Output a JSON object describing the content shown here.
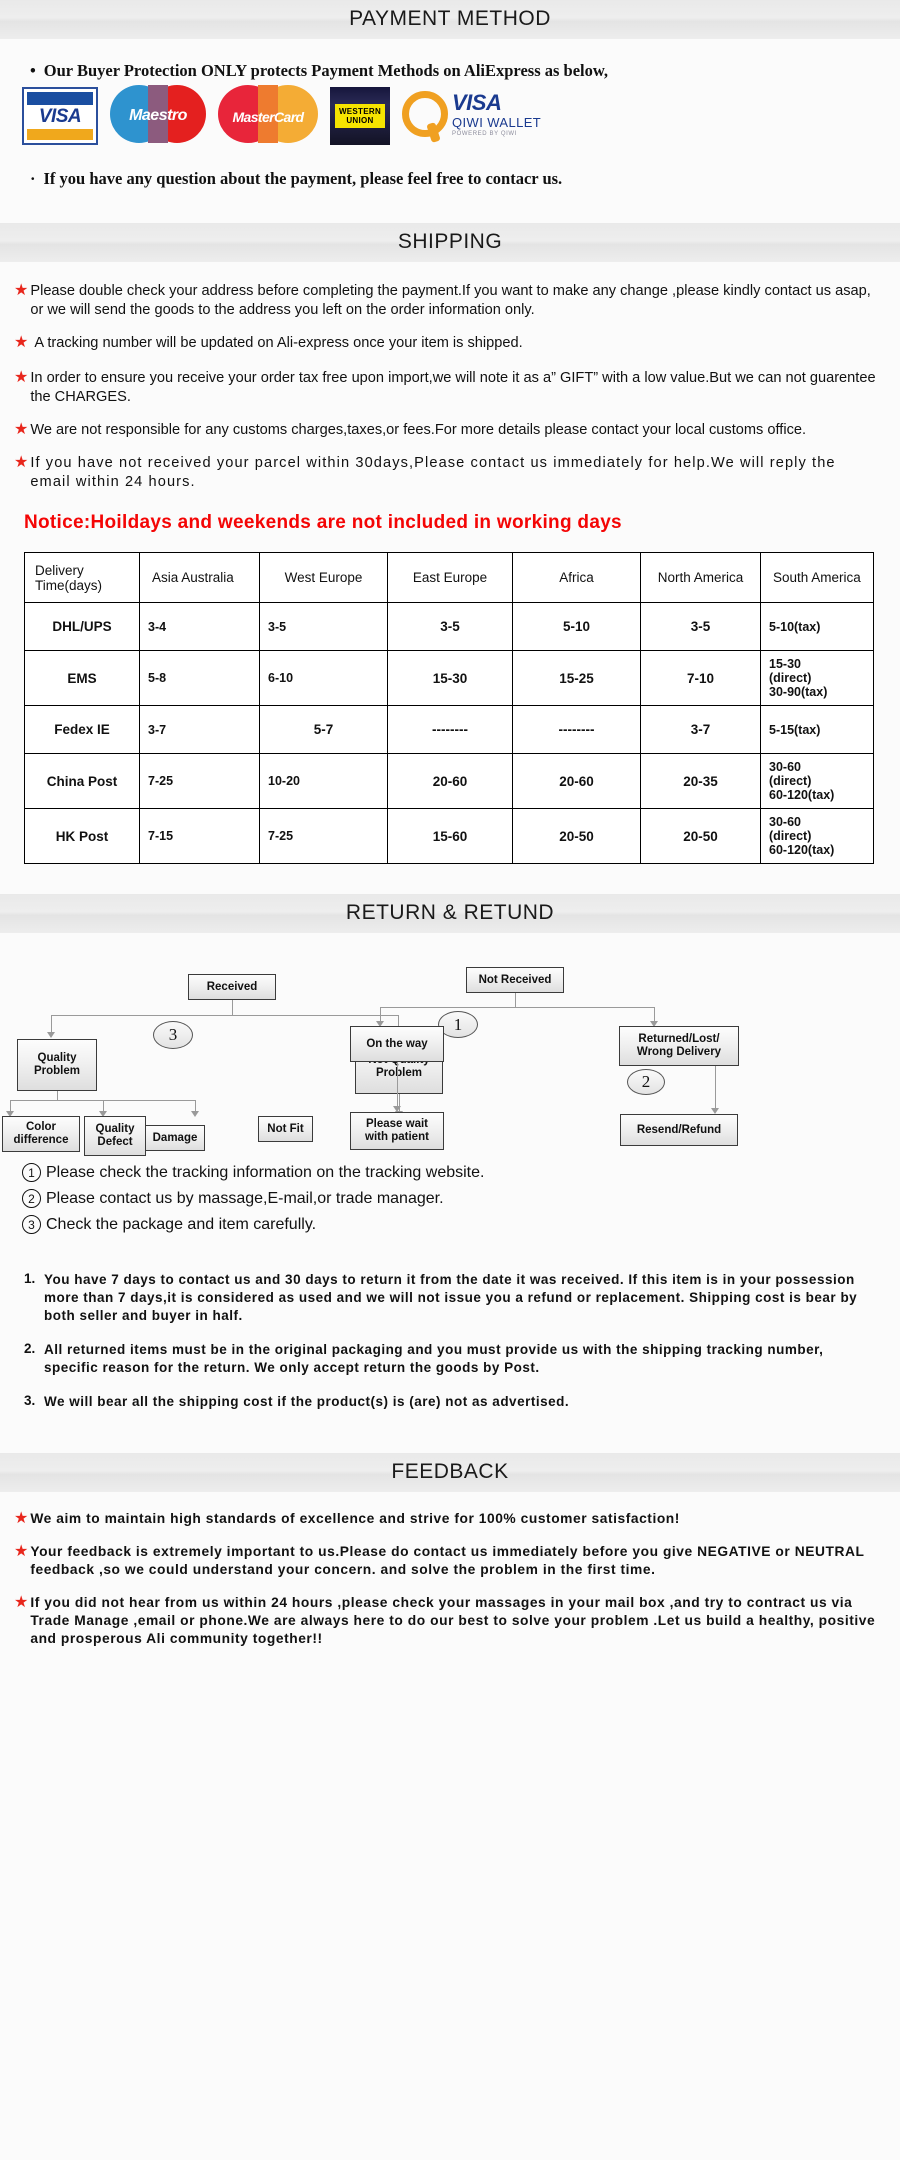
{
  "sections": {
    "payment_title": "PAYMENT METHOD",
    "shipping_title": "SHIPPING",
    "return_title": "RETURN & RETUND",
    "feedback_title": "FEEDBACK"
  },
  "payment": {
    "bullet_top": "Our Buyer Protection ONLY protects Payment Methods on AliExpress as below,",
    "bullet_bottom": "If you have any question about the payment, please feel free to contacr us.",
    "bullet_char": "·",
    "logos": [
      {
        "name": "visa",
        "label": "VISA"
      },
      {
        "name": "maestro",
        "label": "Maestro"
      },
      {
        "name": "mastercard",
        "label": "MasterCard"
      },
      {
        "name": "western-union",
        "line1": "WESTERN",
        "line2": "UNION"
      },
      {
        "name": "qiwi-wallet",
        "visa": "VISA",
        "wallet": "QIWI WALLET",
        "powered": "POWERED BY QIWI"
      }
    ]
  },
  "shipping": {
    "bullets": [
      "Please double check your address before completing the payment.If you want to make any change ,please kindly contact us asap, or we will send the goods to the address you left on the order information only.",
      "A tracking number will be updated on Ali-express once your item is shipped.",
      "In order to ensure you receive your order tax free upon import,we will note it as a” GIFT” with a low value.But we can not guarentee the CHARGES.",
      "We are not responsible for any customs charges,taxes,or fees.For more details please contact your local customs office.",
      "If you have not received your parcel within 30days,Please contact us immediately for help.We will reply the email within 24 hours."
    ],
    "notice": "Notice:Hoildays and weekends are not included in working days",
    "table": {
      "headers": [
        "Delivery Time(days)",
        "Asia Australia",
        "West Europe",
        "East Europe",
        "Africa",
        "North America",
        "South America"
      ],
      "rows": [
        {
          "method": "DHL/UPS",
          "cells": [
            "3-4",
            "3-5",
            "3-5",
            "5-10",
            "3-5",
            "5-10(tax)"
          ]
        },
        {
          "method": "EMS",
          "cells": [
            "5-8",
            "6-10",
            "15-30",
            "15-25",
            "7-10",
            "15-30 (direct) 30-90(tax)"
          ]
        },
        {
          "method": "Fedex IE",
          "cells": [
            "3-7",
            "5-7",
            "--------",
            "--------",
            "3-7",
            "5-15(tax)"
          ]
        },
        {
          "method": "China Post",
          "cells": [
            "7-25",
            "10-20",
            "20-60",
            "20-60",
            "20-35",
            "30-60 (direct) 60-120(tax)"
          ]
        },
        {
          "method": "HK Post",
          "cells": [
            "7-15",
            "7-25",
            "15-60",
            "20-50",
            "20-50",
            "30-60 (direct) 60-120(tax)"
          ]
        }
      ],
      "multiline": {
        "ems_south": [
          "15-30",
          "(direct)",
          "30-90(tax)"
        ],
        "china_south": [
          "30-60",
          "(direct)",
          "60-120(tax)"
        ],
        "hk_south": [
          "30-60",
          "(direct)",
          "60-120(tax)"
        ]
      }
    }
  },
  "flowchart": {
    "left": {
      "root": "Received",
      "badge": "3",
      "branch_a": "Quality Problem",
      "branch_b": "Not Quality Problem",
      "leaves_a": [
        "Color difference",
        "Quality Defect",
        "Damage"
      ],
      "leaf_b": "Not Fit"
    },
    "right": {
      "root": "Not  Received",
      "badge_1": "1",
      "badge_2": "2",
      "branch_a": "On the way",
      "branch_b": "Returned/Lost/ Wrong Delivery",
      "leaf_a": "Please wait with patient",
      "leaf_b": "Resend/Refund"
    }
  },
  "circled_notes": [
    {
      "num": "①",
      "text": "Please check the tracking information on the tracking website."
    },
    {
      "num": "②",
      "text": "Please contact us by  massage,E-mail,or trade manager."
    },
    {
      "num": "③",
      "text": "Check the package and item carefully."
    }
  ],
  "return_policy": [
    {
      "num": "1.",
      "text": "You have 7 days to contact us and 30 days to return it from the date it was received. If this item is in your possession more than 7 days,it is considered as used and we will not issue you a refund or replacement. Shipping cost is bear by both seller and buyer in half."
    },
    {
      "num": "2.",
      "text": "All returned items must be in the original packaging and you must provide us with the shipping tracking number, specific reason for the return. We only accept return the goods by Post."
    },
    {
      "num": "3.",
      "text": "We will bear all the shipping cost if the product(s) is (are) not as advertised."
    }
  ],
  "feedback": {
    "items": [
      "We aim to maintain high standards of excellence and strive  for 100% customer satisfaction!",
      "Your feedback is extremely important to us.Please do contact us immediately before you give NEGATIVE or NEUTRAL feedback ,so  we could understand your concern. and solve the problem in the first time.",
      "If you did not hear from us within 24 hours ,please check your massages in your mail box ,and try to contract us via Trade Manage ,email or phone.We are always here to do our best to solve your problem .Let us build a healthy, positive and prosperous Ali community together!!"
    ]
  },
  "colors": {
    "star_red": "#e8261c",
    "notice_red": "#f40505",
    "header_grey": "#eaeaea",
    "visa_blue": "#1a3a8f",
    "qiwi_orange": "#f0a021"
  }
}
